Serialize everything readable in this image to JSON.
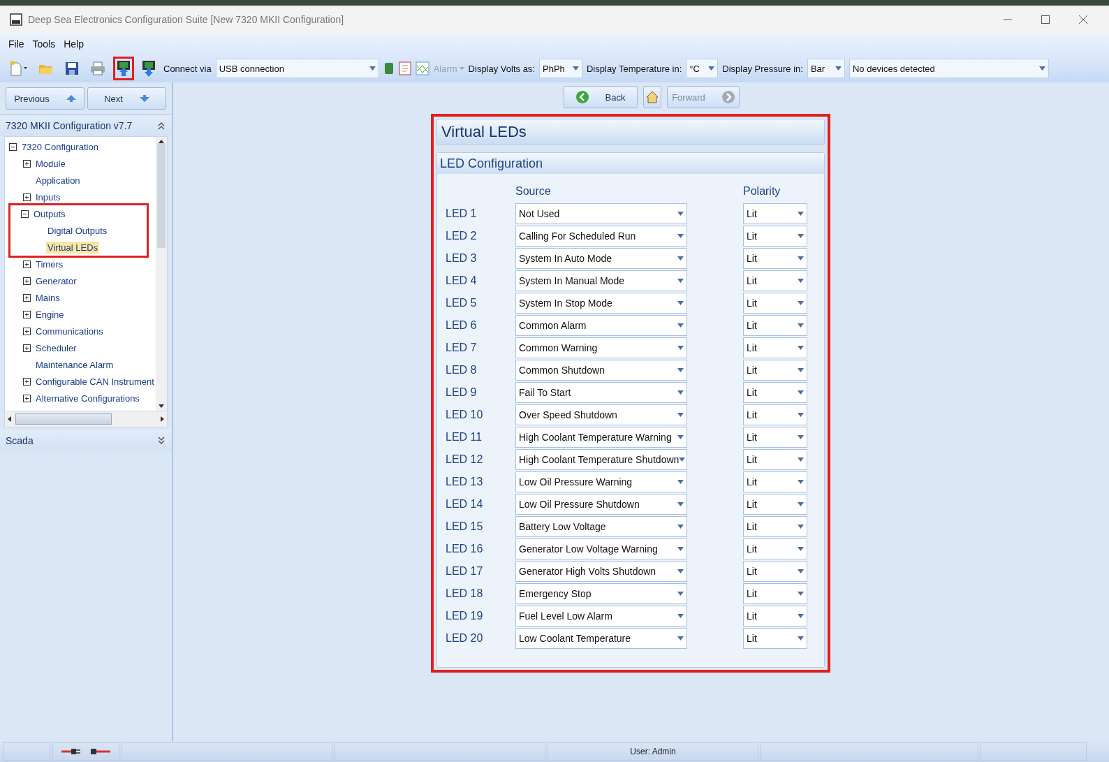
{
  "window": {
    "title": "Deep Sea Electronics Configuration Suite [New 7320 MKII Configuration]"
  },
  "menu": [
    "File",
    "Tools",
    "Help"
  ],
  "toolbar": {
    "tools": [
      {
        "kind": "new",
        "highlighted": false
      },
      {
        "kind": "open",
        "highlighted": false
      },
      {
        "kind": "save",
        "highlighted": false
      },
      {
        "kind": "print",
        "highlighted": false
      },
      {
        "kind": "upload",
        "highlighted": true
      },
      {
        "kind": "download",
        "highlighted": false
      }
    ],
    "connect_label": "Connect via",
    "connect_value": "USB connection",
    "alarm": {
      "label": "Alarm",
      "disabled": true
    },
    "volts_label": "Display Volts as:",
    "volts_value": "PhPh",
    "temp_label": "Display Temperature in:",
    "temp_value": "°C",
    "pressure_label": "Display Pressure in:",
    "pressure_value": "Bar",
    "device_value": "No devices detected"
  },
  "nav": {
    "previous": "Previous",
    "next": "Next",
    "back": "Back",
    "forward": "Forward",
    "forward_disabled": true
  },
  "sidebar": {
    "title": "7320 MKII Configuration v7.7",
    "footer": "Scada",
    "tree": [
      {
        "label": "7320 Configuration",
        "expanded": true,
        "selected": false,
        "children": [
          {
            "label": "Module",
            "expanded": false,
            "selected": false
          },
          {
            "label": "Application",
            "selected": false
          },
          {
            "label": "Inputs",
            "expanded": false,
            "selected": false
          },
          {
            "label": "Outputs",
            "expanded": true,
            "selected": false,
            "highlighted": true,
            "children": [
              {
                "label": "Digital Outputs",
                "selected": false
              },
              {
                "label": "Virtual LEDs",
                "selected": true
              }
            ]
          },
          {
            "label": "Timers",
            "expanded": false,
            "selected": false
          },
          {
            "label": "Generator",
            "expanded": false,
            "selected": false
          },
          {
            "label": "Mains",
            "expanded": false,
            "selected": false
          },
          {
            "label": "Engine",
            "expanded": false,
            "selected": false
          },
          {
            "label": "Communications",
            "expanded": false,
            "selected": false
          },
          {
            "label": "Scheduler",
            "expanded": false,
            "selected": false
          },
          {
            "label": "Maintenance Alarm",
            "selected": false
          },
          {
            "label": "Configurable CAN Instrument",
            "expanded": false,
            "selected": false
          },
          {
            "label": "Alternative Configurations",
            "expanded": false,
            "selected": false
          }
        ]
      }
    ]
  },
  "page": {
    "title": "Virtual LEDs",
    "highlighted": true,
    "section": "LED Configuration",
    "source_heading": "Source",
    "polarity_heading": "Polarity",
    "leds": [
      {
        "label": "LED 1",
        "source": "Not Used",
        "polarity": "Lit"
      },
      {
        "label": "LED 2",
        "source": "Calling For Scheduled Run",
        "polarity": "Lit"
      },
      {
        "label": "LED 3",
        "source": "System In Auto Mode",
        "polarity": "Lit"
      },
      {
        "label": "LED 4",
        "source": "System In Manual Mode",
        "polarity": "Lit"
      },
      {
        "label": "LED 5",
        "source": "System In Stop Mode",
        "polarity": "Lit"
      },
      {
        "label": "LED 6",
        "source": "Common Alarm",
        "polarity": "Lit"
      },
      {
        "label": "LED 7",
        "source": "Common Warning",
        "polarity": "Lit"
      },
      {
        "label": "LED 8",
        "source": "Common Shutdown",
        "polarity": "Lit"
      },
      {
        "label": "LED 9",
        "source": "Fail To Start",
        "polarity": "Lit"
      },
      {
        "label": "LED 10",
        "source": "Over Speed Shutdown",
        "polarity": "Lit"
      },
      {
        "label": "LED 11",
        "source": "High Coolant Temperature Warning",
        "polarity": "Lit"
      },
      {
        "label": "LED 12",
        "source": "High Coolant Temperature Shutdown",
        "polarity": "Lit"
      },
      {
        "label": "LED 13",
        "source": "Low Oil Pressure Warning",
        "polarity": "Lit"
      },
      {
        "label": "LED 14",
        "source": "Low Oil Pressure Shutdown",
        "polarity": "Lit"
      },
      {
        "label": "LED 15",
        "source": "Battery Low Voltage",
        "polarity": "Lit"
      },
      {
        "label": "LED 16",
        "source": "Generator Low Voltage Warning",
        "polarity": "Lit"
      },
      {
        "label": "LED 17",
        "source": "Generator High Volts Shutdown",
        "polarity": "Lit"
      },
      {
        "label": "LED 18",
        "source": "Emergency Stop",
        "polarity": "Lit"
      },
      {
        "label": "LED 19",
        "source": "Fuel Level Low Alarm",
        "polarity": "Lit"
      },
      {
        "label": "LED 20",
        "source": "Low Coolant Temperature",
        "polarity": "Lit"
      }
    ]
  },
  "status_bar": {
    "user": "User: Admin"
  }
}
